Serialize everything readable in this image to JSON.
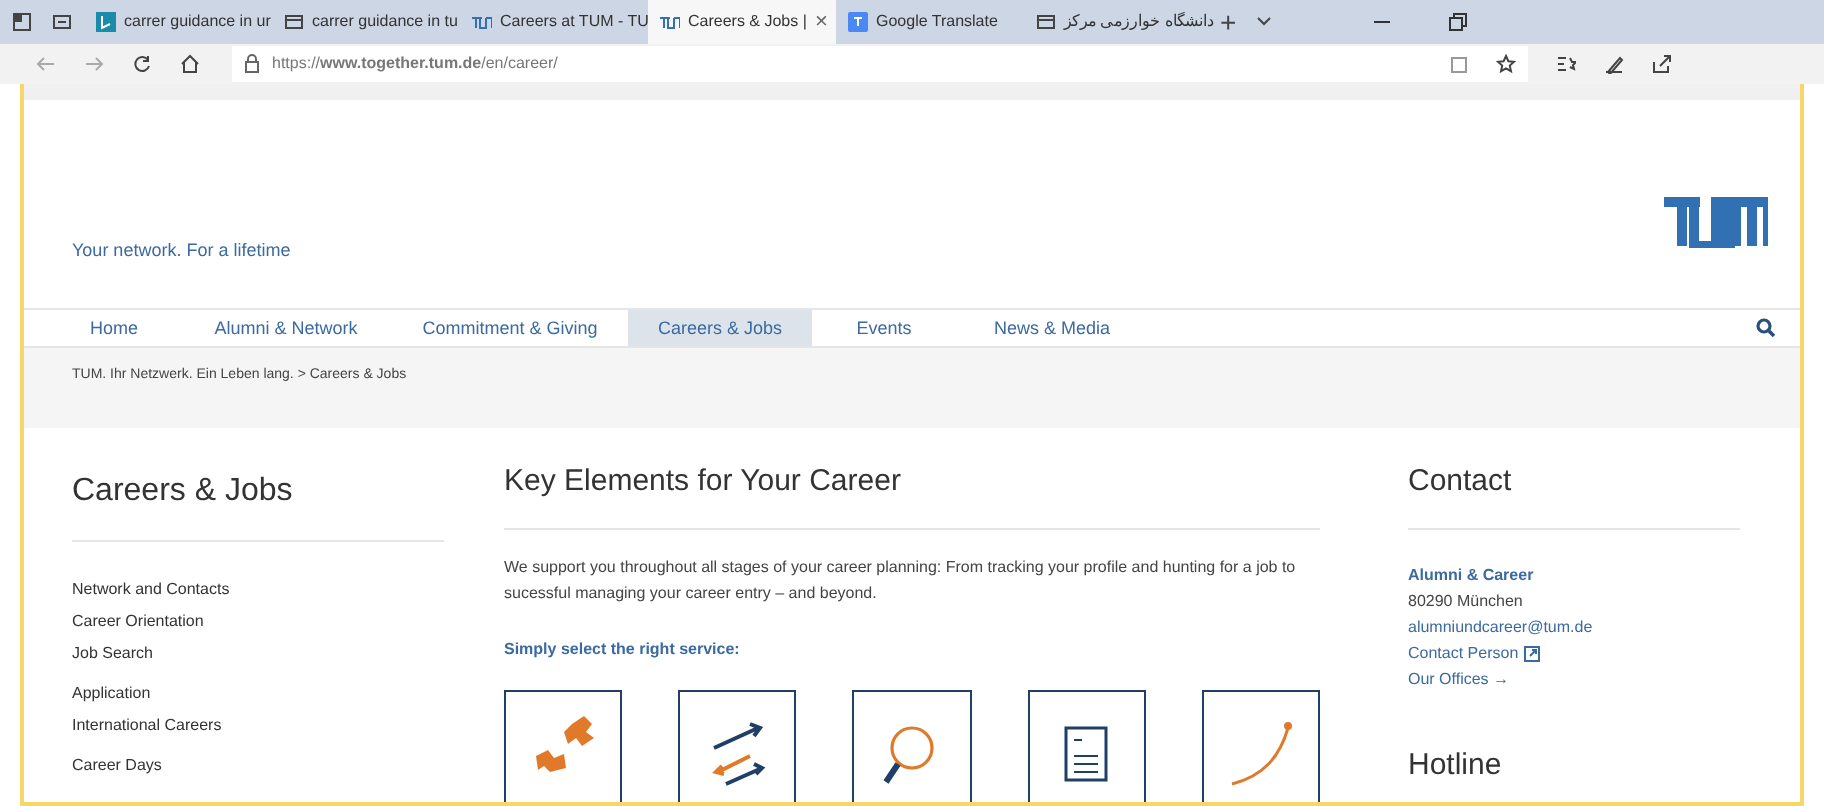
{
  "browser": {
    "tabs": [
      {
        "kind": "bing",
        "title": "carrer guidance in ur",
        "selected": false
      },
      {
        "kind": "page",
        "title": "carrer guidance in tu",
        "selected": false
      },
      {
        "kind": "tum",
        "title": "Careers at TUM - TU",
        "selected": false
      },
      {
        "kind": "tum",
        "title": "Careers & Jobs |",
        "selected": true,
        "close": "×"
      },
      {
        "kind": "translate",
        "title": "Google Translate",
        "selected": false
      },
      {
        "kind": "page",
        "title": "دانشگاه خوارزمی مرکز",
        "selected": false
      }
    ],
    "new_tab": "+",
    "address": "https://**www.together.tum.de**/en/career/"
  },
  "header": {
    "tagline": "Your network. For a lifetime"
  },
  "nav": [
    {
      "label": "Home",
      "selected": false
    },
    {
      "label": "Alumni & Network",
      "selected": false
    },
    {
      "label": "Commitment & Giving",
      "selected": false
    },
    {
      "label": "Careers & Jobs",
      "selected": true
    },
    {
      "label": "Events",
      "selected": false
    },
    {
      "label": "News & Media",
      "selected": false
    }
  ],
  "breadcrumb": "TUM. Ihr Netzwerk. Ein Leben lang. > Careers & Jobs",
  "sidebar": {
    "title": "Careers & Jobs",
    "groups": [
      [
        "Network and Contacts",
        "Career Orientation",
        "Job Search"
      ],
      [
        "Application",
        "International Careers"
      ],
      [
        "Career Days"
      ]
    ]
  },
  "main": {
    "title": "Key Elements for Your Career",
    "intro": "We support you throughout all stages of your career planning: From tracking your profile and hunting for a job to sucessful managing your career entry – and beyond.",
    "prompt": "Simply select the right service:",
    "services": [
      {
        "kind": "puzzle"
      },
      {
        "kind": "arrows"
      },
      {
        "kind": "magnifier"
      },
      {
        "kind": "document"
      },
      {
        "kind": "curve"
      }
    ]
  },
  "contact": {
    "title": "Contact",
    "name": "Alumni & Career",
    "city": "80290 München",
    "email": "alumniundcareer@tum.de",
    "person": "Contact Person",
    "offices": "Our Offices →",
    "hotline_title": "Hotline"
  }
}
